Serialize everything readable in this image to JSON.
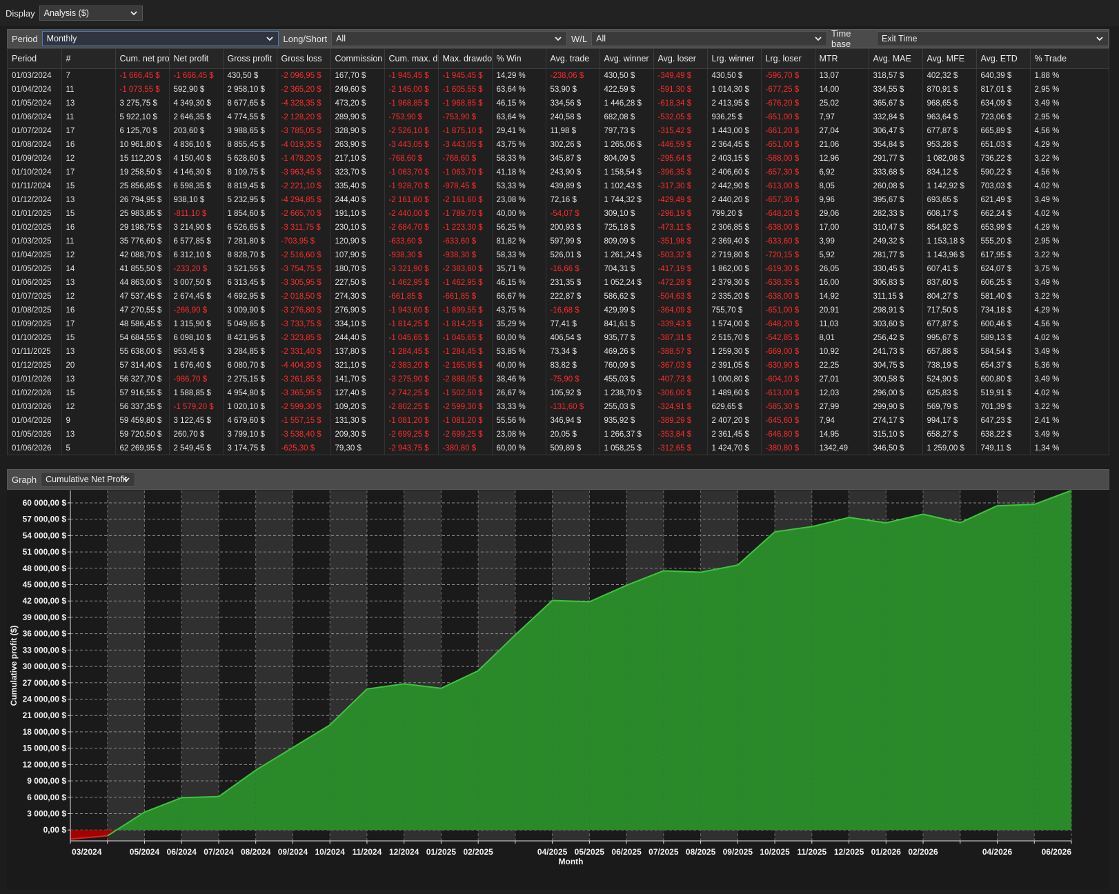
{
  "display": {
    "label": "Display",
    "value": "Analysis ($)"
  },
  "filters": {
    "period": {
      "label": "Period",
      "value": "Monthly"
    },
    "long_short": {
      "label": "Long/Short",
      "value": "All"
    },
    "wl": {
      "label": "W/L",
      "value": "All"
    },
    "time_base": {
      "label": "Time base",
      "value": "Exit Time"
    }
  },
  "table": {
    "columns": [
      "Period",
      "#",
      "Cum. net pro",
      "Net profit",
      "Gross profit",
      "Gross loss",
      "Commission",
      "Cum. max. d",
      "Max. drawdo",
      "% Win",
      "Avg. trade",
      "Avg. winner",
      "Avg. loser",
      "Lrg. winner",
      "Lrg. loser",
      "MTR",
      "Avg. MAE",
      "Avg. MFE",
      "Avg. ETD",
      "% Trade"
    ],
    "rows": [
      [
        "01/03/2024",
        "7",
        "-1 666,45 $",
        "-1 666,45 $",
        "430,50 $",
        "-2 096,95 $",
        "167,70 $",
        "-1 945,45 $",
        "-1 945,45 $",
        "14,29 %",
        "-238,06 $",
        "430,50 $",
        "-349,49 $",
        "430,50 $",
        "-596,70 $",
        "13,07",
        "318,57 $",
        "402,32 $",
        "640,39 $",
        "1,88 %"
      ],
      [
        "01/04/2024",
        "11",
        "-1 073,55 $",
        "592,90 $",
        "2 958,10 $",
        "-2 365,20 $",
        "249,60 $",
        "-2 145,00 $",
        "-1 605,55 $",
        "63,64 %",
        "53,90 $",
        "422,59 $",
        "-591,30 $",
        "1 014,30 $",
        "-677,25 $",
        "14,00",
        "334,55 $",
        "870,91 $",
        "817,01 $",
        "2,95 %"
      ],
      [
        "01/05/2024",
        "13",
        "3 275,75 $",
        "4 349,30 $",
        "8 677,65 $",
        "-4 328,35 $",
        "473,20 $",
        "-1 968,85 $",
        "-1 968,85 $",
        "46,15 %",
        "334,56 $",
        "1 446,28 $",
        "-618,34 $",
        "2 413,95 $",
        "-676,20 $",
        "25,02",
        "365,67 $",
        "968,65 $",
        "634,09 $",
        "3,49 %"
      ],
      [
        "01/06/2024",
        "11",
        "5 922,10 $",
        "2 646,35 $",
        "4 774,55 $",
        "-2 128,20 $",
        "289,90 $",
        "-753,90 $",
        "-753,90 $",
        "63,64 %",
        "240,58 $",
        "682,08 $",
        "-532,05 $",
        "936,25 $",
        "-651,00 $",
        "7,97",
        "332,84 $",
        "963,64 $",
        "723,06 $",
        "2,95 %"
      ],
      [
        "01/07/2024",
        "17",
        "6 125,70 $",
        "203,60 $",
        "3 988,65 $",
        "-3 785,05 $",
        "328,90 $",
        "-2 526,10 $",
        "-1 875,10 $",
        "29,41 %",
        "11,98 $",
        "797,73 $",
        "-315,42 $",
        "1 443,00 $",
        "-661,20 $",
        "27,04",
        "306,47 $",
        "677,87 $",
        "665,89 $",
        "4,56 %"
      ],
      [
        "01/08/2024",
        "16",
        "10 961,80 $",
        "4 836,10 $",
        "8 855,45 $",
        "-4 019,35 $",
        "263,90 $",
        "-3 443,05 $",
        "-3 443,05 $",
        "43,75 %",
        "302,26 $",
        "1 265,06 $",
        "-446,59 $",
        "2 364,45 $",
        "-651,00 $",
        "21,06",
        "354,84 $",
        "953,28 $",
        "651,03 $",
        "4,29 %"
      ],
      [
        "01/09/2024",
        "12",
        "15 112,20 $",
        "4 150,40 $",
        "5 628,60 $",
        "-1 478,20 $",
        "217,10 $",
        "-768,60 $",
        "-768,60 $",
        "58,33 %",
        "345,87 $",
        "804,09 $",
        "-295,64 $",
        "2 403,15 $",
        "-588,00 $",
        "12,96",
        "291,77 $",
        "1 082,08 $",
        "736,22 $",
        "3,22 %"
      ],
      [
        "01/10/2024",
        "17",
        "19 258,50 $",
        "4 146,30 $",
        "8 109,75 $",
        "-3 963,45 $",
        "323,70 $",
        "-1 063,70 $",
        "-1 063,70 $",
        "41,18 %",
        "243,90 $",
        "1 158,54 $",
        "-396,35 $",
        "2 406,60 $",
        "-657,30 $",
        "6,92",
        "333,68 $",
        "834,12 $",
        "590,22 $",
        "4,56 %"
      ],
      [
        "01/11/2024",
        "15",
        "25 856,85 $",
        "6 598,35 $",
        "8 819,45 $",
        "-2 221,10 $",
        "335,40 $",
        "-1 928,70 $",
        "-978,45 $",
        "53,33 %",
        "439,89 $",
        "1 102,43 $",
        "-317,30 $",
        "2 442,90 $",
        "-613,00 $",
        "8,05",
        "260,08 $",
        "1 142,92 $",
        "703,03 $",
        "4,02 %"
      ],
      [
        "01/12/2024",
        "13",
        "26 794,95 $",
        "938,10 $",
        "5 232,95 $",
        "-4 294,85 $",
        "244,40 $",
        "-2 161,60 $",
        "-2 161,60 $",
        "23,08 %",
        "72,16 $",
        "1 744,32 $",
        "-429,49 $",
        "2 440,20 $",
        "-657,30 $",
        "9,96",
        "395,67 $",
        "693,65 $",
        "621,49 $",
        "3,49 %"
      ],
      [
        "01/01/2025",
        "15",
        "25 983,85 $",
        "-811,10 $",
        "1 854,60 $",
        "-2 665,70 $",
        "191,10 $",
        "-2 440,00 $",
        "-1 789,70 $",
        "40,00 %",
        "-54,07 $",
        "309,10 $",
        "-296,19 $",
        "799,20 $",
        "-648,20 $",
        "29,06",
        "282,33 $",
        "608,17 $",
        "662,24 $",
        "4,02 %"
      ],
      [
        "01/02/2025",
        "16",
        "29 198,75 $",
        "3 214,90 $",
        "6 526,65 $",
        "-3 311,75 $",
        "230,10 $",
        "-2 684,70 $",
        "-1 223,30 $",
        "56,25 %",
        "200,93 $",
        "725,18 $",
        "-473,11 $",
        "2 306,85 $",
        "-638,00 $",
        "17,00",
        "310,47 $",
        "854,92 $",
        "653,99 $",
        "4,29 %"
      ],
      [
        "01/03/2025",
        "11",
        "35 776,60 $",
        "6 577,85 $",
        "7 281,80 $",
        "-703,95 $",
        "120,90 $",
        "-633,60 $",
        "-633,60 $",
        "81,82 %",
        "597,99 $",
        "809,09 $",
        "-351,98 $",
        "2 369,40 $",
        "-633,60 $",
        "3,99",
        "249,32 $",
        "1 153,18 $",
        "555,20 $",
        "2,95 %"
      ],
      [
        "01/04/2025",
        "12",
        "42 088,70 $",
        "6 312,10 $",
        "8 828,70 $",
        "-2 516,60 $",
        "107,90 $",
        "-938,30 $",
        "-938,30 $",
        "58,33 %",
        "526,01 $",
        "1 261,24 $",
        "-503,32 $",
        "2 719,80 $",
        "-720,15 $",
        "5,92",
        "281,77 $",
        "1 143,96 $",
        "617,95 $",
        "3,22 %"
      ],
      [
        "01/05/2025",
        "14",
        "41 855,50 $",
        "-233,20 $",
        "3 521,55 $",
        "-3 754,75 $",
        "180,70 $",
        "-3 321,90 $",
        "-2 383,60 $",
        "35,71 %",
        "-16,66 $",
        "704,31 $",
        "-417,19 $",
        "1 862,00 $",
        "-619,30 $",
        "26,05",
        "330,45 $",
        "607,41 $",
        "624,07 $",
        "3,75 %"
      ],
      [
        "01/06/2025",
        "13",
        "44 863,00 $",
        "3 007,50 $",
        "6 313,45 $",
        "-3 305,95 $",
        "227,50 $",
        "-1 462,95 $",
        "-1 462,95 $",
        "46,15 %",
        "231,35 $",
        "1 052,24 $",
        "-472,28 $",
        "2 379,30 $",
        "-638,35 $",
        "16,00",
        "306,83 $",
        "837,60 $",
        "606,25 $",
        "3,49 %"
      ],
      [
        "01/07/2025",
        "12",
        "47 537,45 $",
        "2 674,45 $",
        "4 692,95 $",
        "-2 018,50 $",
        "274,30 $",
        "-661,85 $",
        "-661,85 $",
        "66,67 %",
        "222,87 $",
        "586,62 $",
        "-504,63 $",
        "2 335,20 $",
        "-638,00 $",
        "14,92",
        "311,15 $",
        "804,27 $",
        "581,40 $",
        "3,22 %"
      ],
      [
        "01/08/2025",
        "16",
        "47 270,55 $",
        "-266,90 $",
        "3 009,90 $",
        "-3 276,80 $",
        "276,90 $",
        "-1 943,60 $",
        "-1 899,55 $",
        "43,75 %",
        "-16,68 $",
        "429,99 $",
        "-364,09 $",
        "755,70 $",
        "-651,00 $",
        "20,91",
        "298,91 $",
        "717,50 $",
        "734,18 $",
        "4,29 %"
      ],
      [
        "01/09/2025",
        "17",
        "48 586,45 $",
        "1 315,90 $",
        "5 049,65 $",
        "-3 733,75 $",
        "334,10 $",
        "-1 814,25 $",
        "-1 814,25 $",
        "35,29 %",
        "77,41 $",
        "841,61 $",
        "-339,43 $",
        "1 574,00 $",
        "-648,20 $",
        "11,03",
        "303,60 $",
        "677,87 $",
        "600,46 $",
        "4,56 %"
      ],
      [
        "01/10/2025",
        "15",
        "54 684,55 $",
        "6 098,10 $",
        "8 421,95 $",
        "-2 323,85 $",
        "244,40 $",
        "-1 045,65 $",
        "-1 045,65 $",
        "60,00 %",
        "406,54 $",
        "935,77 $",
        "-387,31 $",
        "2 515,70 $",
        "-542,85 $",
        "8,01",
        "256,42 $",
        "995,67 $",
        "589,13 $",
        "4,02 %"
      ],
      [
        "01/11/2025",
        "13",
        "55 638,00 $",
        "953,45 $",
        "3 284,85 $",
        "-2 331,40 $",
        "137,80 $",
        "-1 284,45 $",
        "-1 284,45 $",
        "53,85 %",
        "73,34 $",
        "469,26 $",
        "-388,57 $",
        "1 259,30 $",
        "-669,00 $",
        "10,92",
        "241,73 $",
        "657,88 $",
        "584,54 $",
        "3,49 %"
      ],
      [
        "01/12/2025",
        "20",
        "57 314,40 $",
        "1 676,40 $",
        "6 080,70 $",
        "-4 404,30 $",
        "321,10 $",
        "-2 383,20 $",
        "-2 165,95 $",
        "40,00 %",
        "83,82 $",
        "760,09 $",
        "-367,03 $",
        "2 391,05 $",
        "-630,90 $",
        "22,25",
        "304,75 $",
        "738,19 $",
        "654,37 $",
        "5,36 %"
      ],
      [
        "01/01/2026",
        "13",
        "56 327,70 $",
        "-986,70 $",
        "2 275,15 $",
        "-3 261,85 $",
        "141,70 $",
        "-3 275,90 $",
        "-2 888,05 $",
        "38,46 %",
        "-75,90 $",
        "455,03 $",
        "-407,73 $",
        "1 000,80 $",
        "-604,10 $",
        "27,01",
        "300,58 $",
        "524,90 $",
        "600,80 $",
        "3,49 %"
      ],
      [
        "01/02/2026",
        "15",
        "57 916,55 $",
        "1 588,85 $",
        "4 954,80 $",
        "-3 365,95 $",
        "127,40 $",
        "-2 742,25 $",
        "-1 502,50 $",
        "26,67 %",
        "105,92 $",
        "1 238,70 $",
        "-306,00 $",
        "1 489,60 $",
        "-613,00 $",
        "12,03",
        "296,00 $",
        "625,83 $",
        "519,91 $",
        "4,02 %"
      ],
      [
        "01/03/2026",
        "12",
        "56 337,35 $",
        "-1 579,20 $",
        "1 020,10 $",
        "-2 599,30 $",
        "109,20 $",
        "-2 802,25 $",
        "-2 599,30 $",
        "33,33 %",
        "-131,60 $",
        "255,03 $",
        "-324,91 $",
        "629,65 $",
        "-585,30 $",
        "27,99",
        "299,90 $",
        "569,79 $",
        "701,39 $",
        "3,22 %"
      ],
      [
        "01/04/2026",
        "9",
        "59 459,80 $",
        "3 122,45 $",
        "4 679,60 $",
        "-1 557,15 $",
        "131,30 $",
        "-1 081,20 $",
        "-1 081,20 $",
        "55,56 %",
        "346,94 $",
        "935,92 $",
        "-389,29 $",
        "2 407,20 $",
        "-645,60 $",
        "7,94",
        "274,17 $",
        "994,17 $",
        "647,23 $",
        "2,41 %"
      ],
      [
        "01/05/2026",
        "13",
        "59 720,50 $",
        "260,70 $",
        "3 799,10 $",
        "-3 538,40 $",
        "209,30 $",
        "-2 699,25 $",
        "-2 699,25 $",
        "23,08 %",
        "20,05 $",
        "1 266,37 $",
        "-353,84 $",
        "2 361,45 $",
        "-646,80 $",
        "14,95",
        "315,10 $",
        "658,27 $",
        "638,22 $",
        "3,49 %"
      ],
      [
        "01/06/2026",
        "5",
        "62 269,95 $",
        "2 549,45 $",
        "3 174,75 $",
        "-625,30 $",
        "79,30 $",
        "-2 943,75 $",
        "-380,80 $",
        "60,00 %",
        "509,89 $",
        "1 058,25 $",
        "-312,65 $",
        "1 424,70 $",
        "-380,80 $",
        "1342,49",
        "346,50 $",
        "1 259,00 $",
        "749,11 $",
        "1,34 %"
      ]
    ]
  },
  "graph": {
    "label": "Graph",
    "value": "Cumulative Net Profit"
  },
  "chart_data": {
    "type": "area",
    "xlabel": "Month",
    "ylabel": "Cumulative profit ($)",
    "ylim": [
      -2000,
      62269.95
    ],
    "yticks": [
      0,
      3000,
      6000,
      9000,
      12000,
      15000,
      18000,
      21000,
      24000,
      27000,
      30000,
      33000,
      36000,
      39000,
      42000,
      45000,
      48000,
      51000,
      54000,
      57000,
      60000
    ],
    "ytick_labels": [
      "0,00 $",
      "3 000,00 $",
      "6 000,00 $",
      "9 000,00 $",
      "12 000,00 $",
      "15 000,00 $",
      "18 000,00 $",
      "21 000,00 $",
      "24 000,00 $",
      "27 000,00 $",
      "30 000,00 $",
      "33 000,00 $",
      "36 000,00 $",
      "39 000,00 $",
      "42 000,00 $",
      "45 000,00 $",
      "48 000,00 $",
      "51 000,00 $",
      "54 000,00 $",
      "57 000,00 $",
      "60 000,00 $"
    ],
    "x": [
      "03/2024",
      "04/2024",
      "05/2024",
      "06/2024",
      "07/2024",
      "08/2024",
      "09/2024",
      "10/2024",
      "11/2024",
      "12/2024",
      "01/2025",
      "02/2025",
      "03/2025",
      "04/2025",
      "05/2025",
      "06/2025",
      "07/2025",
      "08/2025",
      "09/2025",
      "10/2025",
      "11/2025",
      "12/2025",
      "01/2026",
      "02/2026",
      "03/2026",
      "04/2026",
      "05/2026",
      "06/2026"
    ],
    "xtick_labels": [
      "03/2024",
      "",
      "05/2024",
      "06/2024",
      "07/2024",
      "08/2024",
      "09/2024",
      "10/2024",
      "11/2024",
      "12/2024",
      "01/2025",
      "02/2025",
      "",
      "04/2025",
      "05/2025",
      "06/2025",
      "07/2025",
      "08/2025",
      "09/2025",
      "10/2025",
      "11/2025",
      "12/2025",
      "01/2026",
      "02/2026",
      "",
      "04/2026",
      "",
      "06/2026"
    ],
    "values": [
      -1666.45,
      -1073.55,
      3275.75,
      5922.1,
      6125.7,
      10961.8,
      15112.2,
      19258.5,
      25856.85,
      26794.95,
      25983.85,
      29198.75,
      35776.6,
      42088.7,
      41855.5,
      44863.0,
      47537.45,
      47270.55,
      48586.45,
      54684.55,
      55638.0,
      57314.4,
      56327.7,
      57916.55,
      56337.35,
      59459.8,
      59720.5,
      62269.95
    ],
    "colors": {
      "positive_fill": "#2a8a2a",
      "positive_line": "#3ec43e",
      "negative_fill": "#a30000",
      "negative_line": "#e02020"
    },
    "grid": true
  }
}
